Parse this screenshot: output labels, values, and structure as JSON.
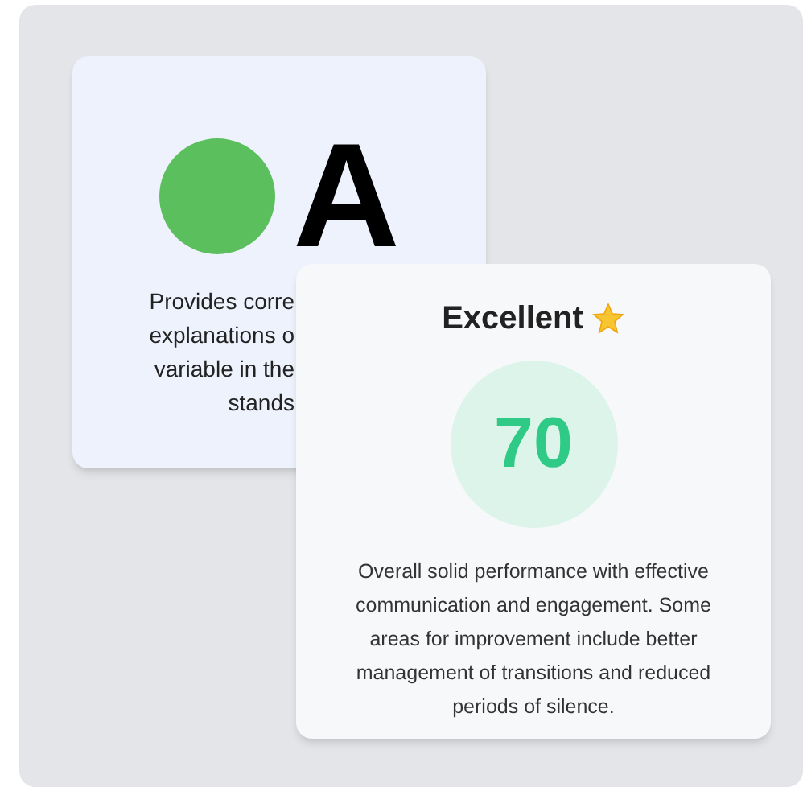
{
  "back_card": {
    "grade": "A",
    "description_lines": [
      "Provides corre",
      "explanations o",
      "variable in the",
      "stands"
    ]
  },
  "front_card": {
    "title": "Excellent",
    "score": "70",
    "summary": "Overall solid performance with effective communication and engagement. Some areas for improvement include better management of transitions and reduced periods of silence."
  }
}
